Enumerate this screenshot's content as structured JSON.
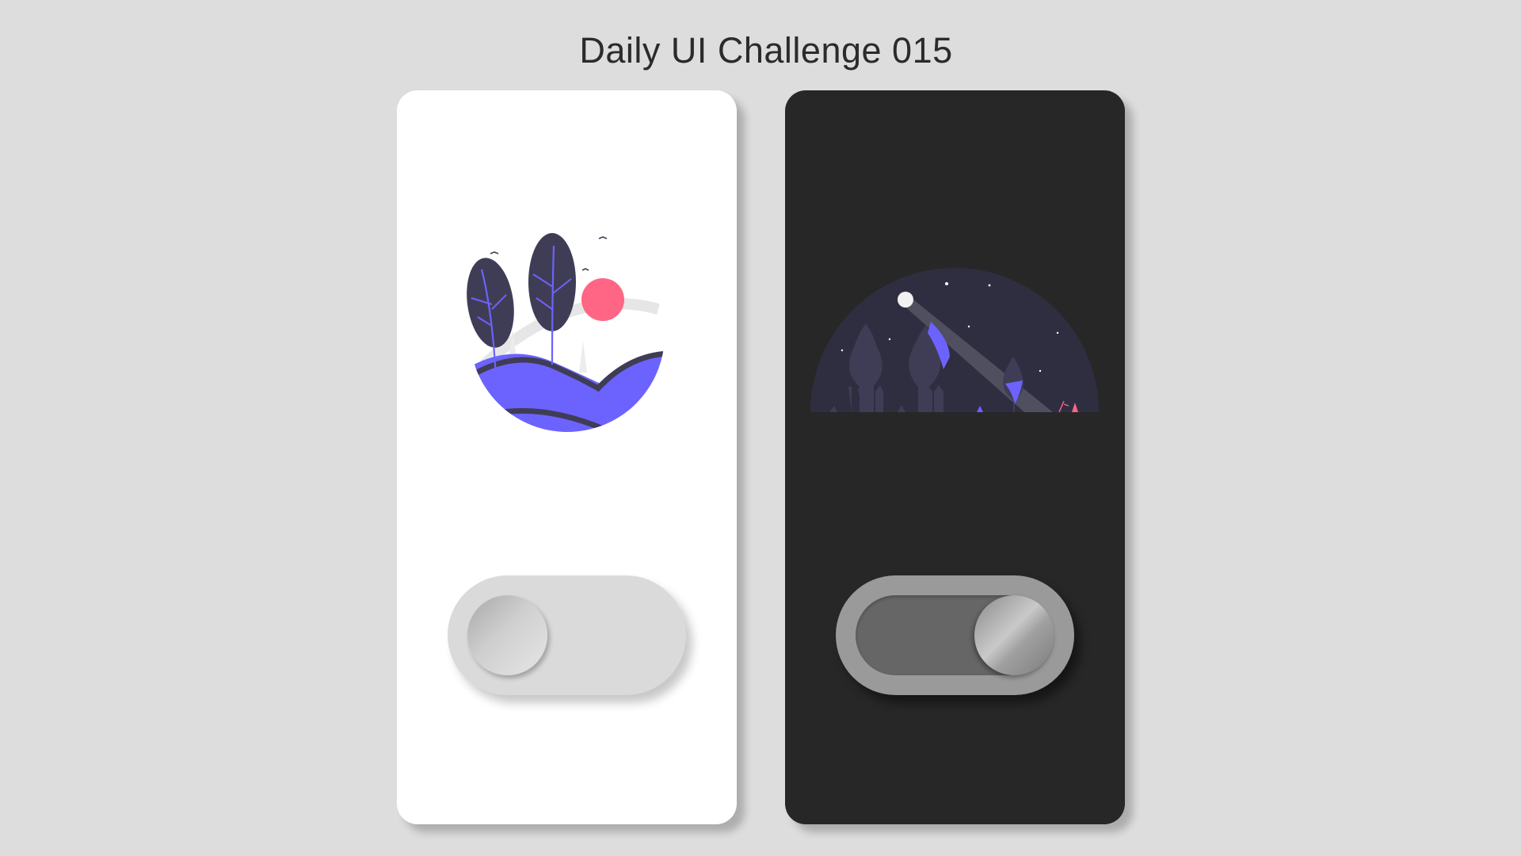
{
  "page": {
    "title": "Daily UI Challenge 015"
  },
  "colors": {
    "background": "#dddddd",
    "light_card": "#ffffff",
    "dark_card": "#272727",
    "accent_purple": "#6c63ff",
    "dark_navy": "#3f3d56",
    "sun_pink": "#ff6584",
    "night_sky": "#2f2e41"
  },
  "cards": [
    {
      "theme": "light",
      "illustration_icon": "day-landscape-illustration",
      "toggle": {
        "state": "off",
        "knob_side": "left"
      }
    },
    {
      "theme": "dark",
      "illustration_icon": "night-landscape-illustration",
      "toggle": {
        "state": "on",
        "knob_side": "right"
      }
    }
  ]
}
